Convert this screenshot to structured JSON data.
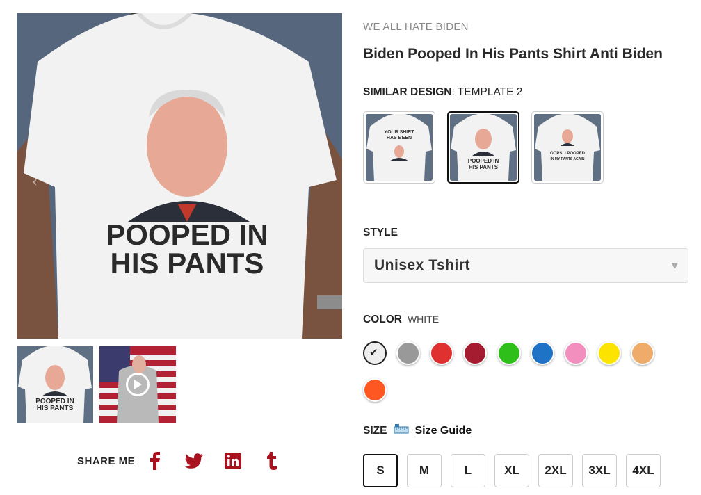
{
  "gallery": {
    "prev_arrow": "‹",
    "next_arrow": "›",
    "main_print_line1": "POOPED IN",
    "main_print_line2": "HIS PANTS",
    "thumb_print_line1": "POOPED IN",
    "thumb_print_line2": "HIS PANTS",
    "video_icon": "play-circle-icon"
  },
  "share": {
    "label": "SHARE ME",
    "accent_color": "#a8121e",
    "icons": [
      "facebook-icon",
      "twitter-icon",
      "linkedin-icon",
      "tumblr-icon"
    ]
  },
  "product": {
    "brand": "WE ALL HATE BIDEN",
    "title": "Biden Pooped In His Pants Shirt Anti Biden"
  },
  "similar_design": {
    "label": "SIMILAR DESIGN",
    "value": "TEMPLATE 2",
    "options": [
      {
        "print_line1": "YOUR SHIRT",
        "print_line2": "HAS BEEN"
      },
      {
        "print_line1": "POOPED IN",
        "print_line2": "HIS PANTS"
      },
      {
        "print_line1": "OOPS! I POOPED",
        "print_line2": "IN MY PANTS AGAIN"
      }
    ],
    "selected_index": 1
  },
  "style": {
    "label": "STYLE",
    "value": "Unisex Tshirt",
    "arrow": "▼"
  },
  "color": {
    "label": "COLOR",
    "value": "WHITE",
    "check": "✔",
    "swatches": [
      "#eeeeee",
      "#999999",
      "#e03131",
      "#a51c30",
      "#2fbf1a",
      "#1f73c7",
      "#f38fbe",
      "#fde400",
      "#eeab6a",
      "#ff5722"
    ],
    "selected_index": 0
  },
  "size": {
    "label": "SIZE",
    "guide_label": "Size Guide",
    "options": [
      "S",
      "M",
      "L",
      "XL",
      "2XL",
      "3XL",
      "4XL"
    ],
    "selected_index": 0
  }
}
